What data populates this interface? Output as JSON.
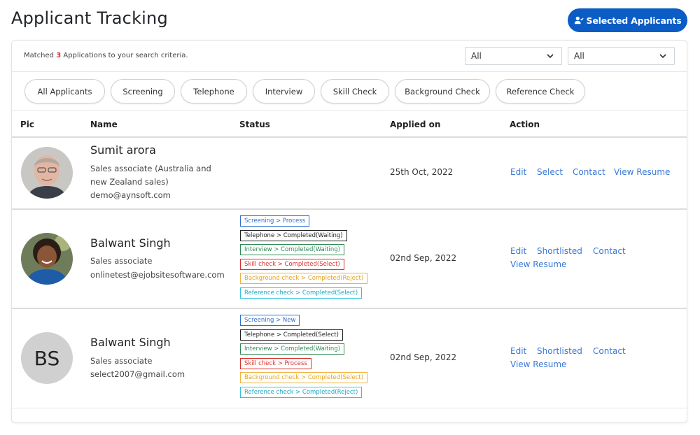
{
  "header": {
    "title": "Applicant Tracking",
    "selected_button": "Selected Applicants"
  },
  "summary": {
    "prefix": "Matched",
    "count": "3",
    "suffix": "Applications to your search criteria."
  },
  "filters": [
    {
      "value": "All"
    },
    {
      "value": "All"
    }
  ],
  "tabs": [
    {
      "label": "All Applicants"
    },
    {
      "label": "Screening"
    },
    {
      "label": "Telephone"
    },
    {
      "label": "Interview"
    },
    {
      "label": "Skill Check"
    },
    {
      "label": "Background Check"
    },
    {
      "label": "Reference Check"
    }
  ],
  "columns": {
    "pic": "Pic",
    "name": "Name",
    "status": "Status",
    "applied": "Applied on",
    "action": "Action"
  },
  "applicants": [
    {
      "name": "Sumit arora",
      "role_line1": "Sales associate (Australia and",
      "role_line2": "new Zealand sales)",
      "email": "demo@aynsoft.com",
      "applied_on": "25th Oct, 2022",
      "actions": [
        "Edit",
        "Select",
        "Contact",
        "View Resume"
      ]
    },
    {
      "name": "Balwant Singh",
      "role": "Sales associate",
      "email": "onlinetest@ejobsitesoftware.com",
      "applied_on": "02nd Sep, 2022",
      "statuses": [
        {
          "text": "Screening > Process",
          "color": "#2d6fd0"
        },
        {
          "text": "Telephone > Completed(Waiting)",
          "color": "#222222"
        },
        {
          "text": "Interview > Completed(Waiting)",
          "color": "#2f8a54"
        },
        {
          "text": "Skill check > Completed(Select)",
          "color": "#d9302c"
        },
        {
          "text": "Background check > Completed(Reject)",
          "color": "#e8a21a"
        },
        {
          "text": "Reference check > Completed(Select)",
          "color": "#1aa9c9"
        }
      ],
      "actions": [
        "Edit",
        "Shortlisted",
        "Contact",
        "View Resume"
      ]
    },
    {
      "name": "Balwant Singh",
      "initials": "BS",
      "role": "Sales associate",
      "email": "select2007@gmail.com",
      "applied_on": "02nd Sep, 2022",
      "statuses": [
        {
          "text": "Screening > New",
          "color": "#2d6fd0"
        },
        {
          "text": "Telephone > Completed(Select)",
          "color": "#222222"
        },
        {
          "text": "Interview > Completed(Waiting)",
          "color": "#2f8a54"
        },
        {
          "text": "Skill check > Process",
          "color": "#d9302c"
        },
        {
          "text": "Background check > Completed(Select)",
          "color": "#e8a21a"
        },
        {
          "text": "Reference check > Completed(Reject)",
          "color": "#1aa9c9"
        }
      ],
      "actions": [
        "Edit",
        "Shortlisted",
        "Contact",
        "View Resume"
      ]
    }
  ],
  "colors": {
    "primary": "#0b5cc4",
    "link": "#3a78d6",
    "count": "#d9302c"
  }
}
